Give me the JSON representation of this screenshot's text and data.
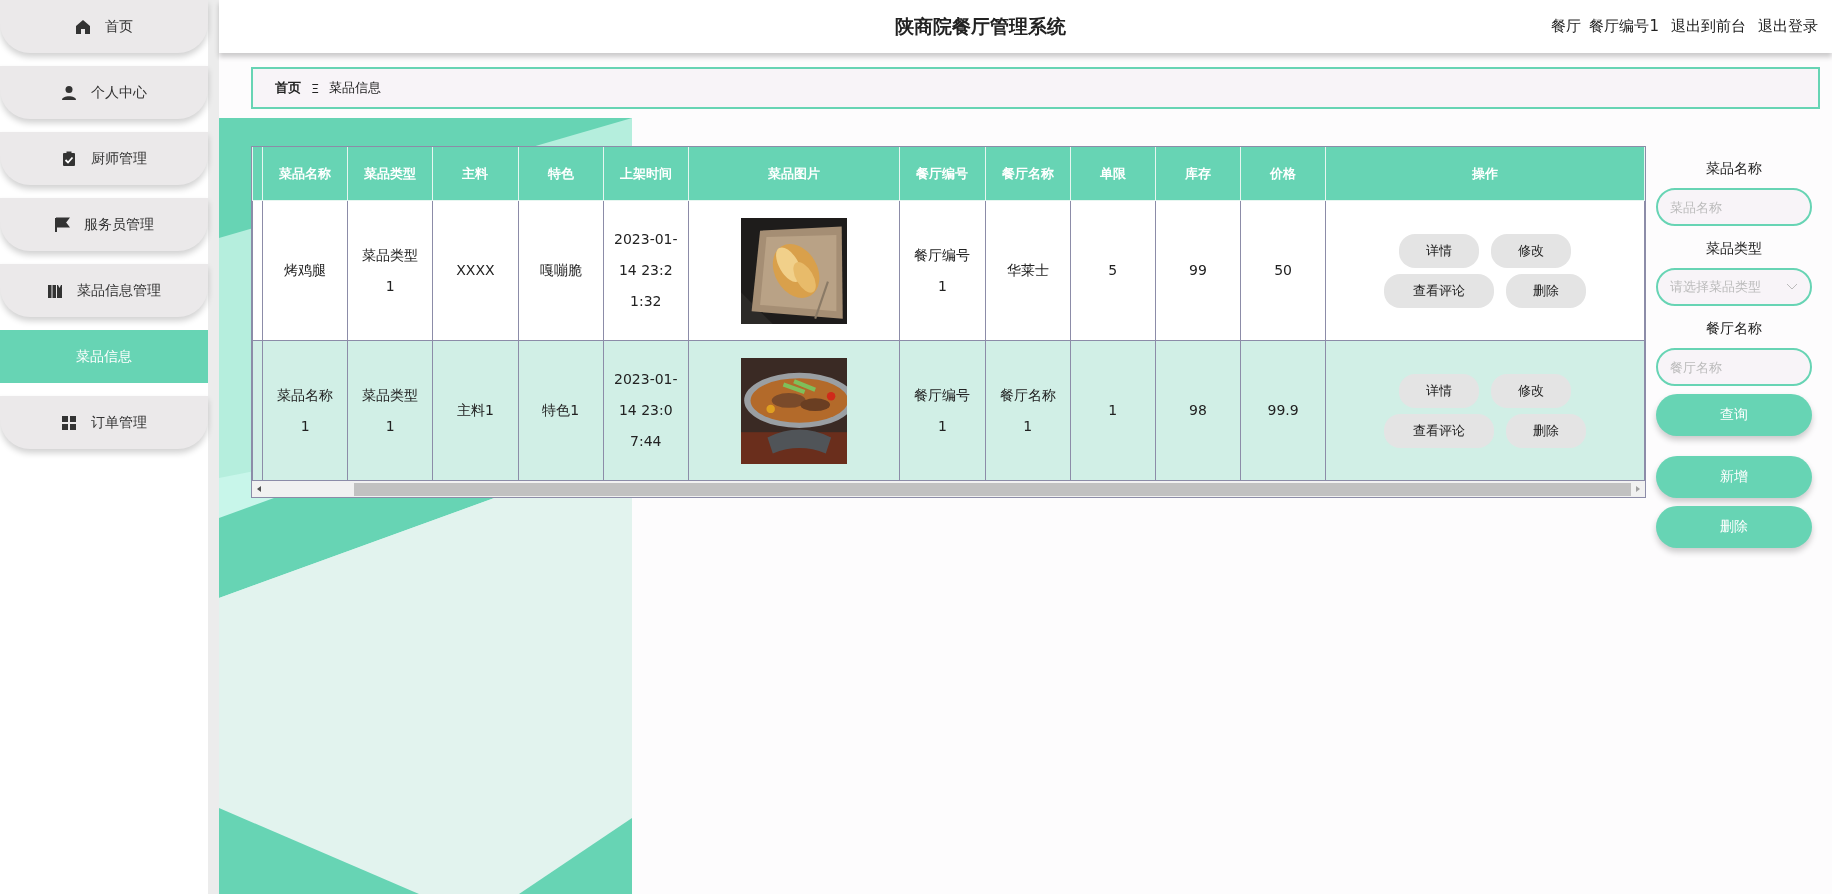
{
  "sidebar": {
    "items": [
      {
        "label": "首页",
        "selected": false
      },
      {
        "label": "个人中心",
        "selected": false
      },
      {
        "label": "厨师管理",
        "selected": false
      },
      {
        "label": "服务员管理",
        "selected": false
      },
      {
        "label": "菜品信息管理",
        "selected": false
      },
      {
        "label": "菜品信息",
        "selected": true
      },
      {
        "label": "订单管理",
        "selected": false
      }
    ]
  },
  "header": {
    "title": "陕商院餐厅管理系统",
    "user": [
      "餐厅",
      "餐厅编号1"
    ],
    "links": [
      "退出到前台",
      "退出登录"
    ]
  },
  "breadcrumb": {
    "items": [
      "首页",
      "菜品信息"
    ],
    "separator": "Ξ"
  },
  "table": {
    "columns": [
      "菜品名称",
      "菜品类型",
      "主料",
      "特色",
      "上架时间",
      "菜品图片",
      "餐厅编号",
      "餐厅名称",
      "单限",
      "库存",
      "价格",
      "操作"
    ],
    "rows": [
      {
        "cells": [
          "烤鸡腿",
          "菜品类型1",
          "XXXX",
          "嘎嘣脆",
          "2023-01-14 23:21:32"
        ],
        "image": {
          "kind": "picture"
        },
        "cells2": [
          "餐厅编号1",
          "华莱士",
          "5",
          "99",
          "50"
        ],
        "actions": [
          "详情",
          "修改",
          "查看评论",
          "删除"
        ]
      },
      {
        "cells": [
          "菜品名称1",
          "菜品类型1",
          "主料1",
          "特色1",
          "2023-01-14 23:07:44"
        ],
        "image": {
          "kind": "picture"
        },
        "cells2": [
          "餐厅编号1",
          "餐厅名称1",
          "1",
          "98",
          "99.9"
        ],
        "actions": [
          "详情",
          "修改",
          "查看评论",
          "删除"
        ]
      }
    ]
  },
  "search": {
    "fields": [
      {
        "label": "菜品名称",
        "kind": "input",
        "placeholder": "菜品名称"
      },
      {
        "label": "菜品类型",
        "kind": "select",
        "placeholder": "请选择菜品类型"
      },
      {
        "label": "餐厅名称",
        "kind": "input",
        "placeholder": "餐厅名称"
      }
    ],
    "query_button": "查询",
    "buttons": [
      "新增",
      "删除"
    ]
  }
}
